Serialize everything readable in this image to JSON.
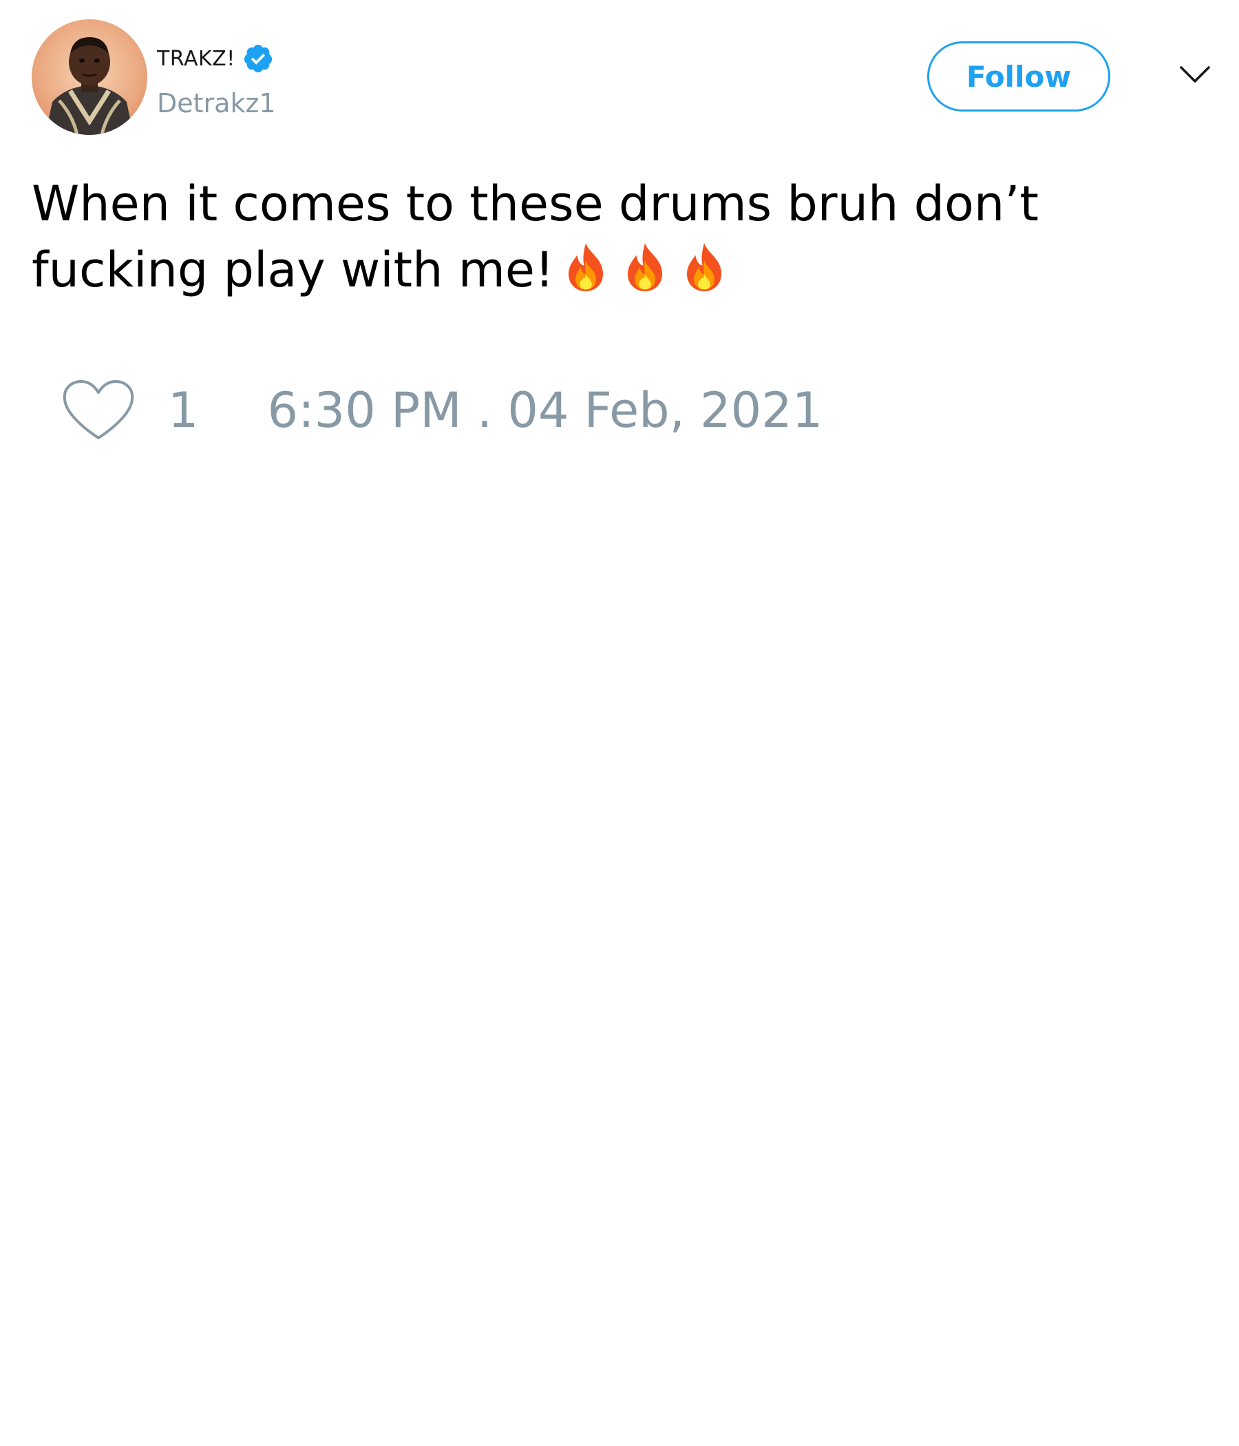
{
  "user": {
    "display_name": "TRAKZ!",
    "handle": "Detrakz1",
    "verified": true,
    "avatar_icon": "profile-photo"
  },
  "follow_label": "Follow",
  "tweet": {
    "text": "When it comes to these drums bruh don’t fucking play with me!",
    "emojis": [
      "fire-emoji",
      "fire-emoji",
      "fire-emoji"
    ]
  },
  "footer": {
    "like_count": "1",
    "timestamp": "6:30 PM . 04 Feb, 2021"
  },
  "colors": {
    "accent": "#1da1f2",
    "muted": "#8899a6",
    "text": "#000000"
  }
}
